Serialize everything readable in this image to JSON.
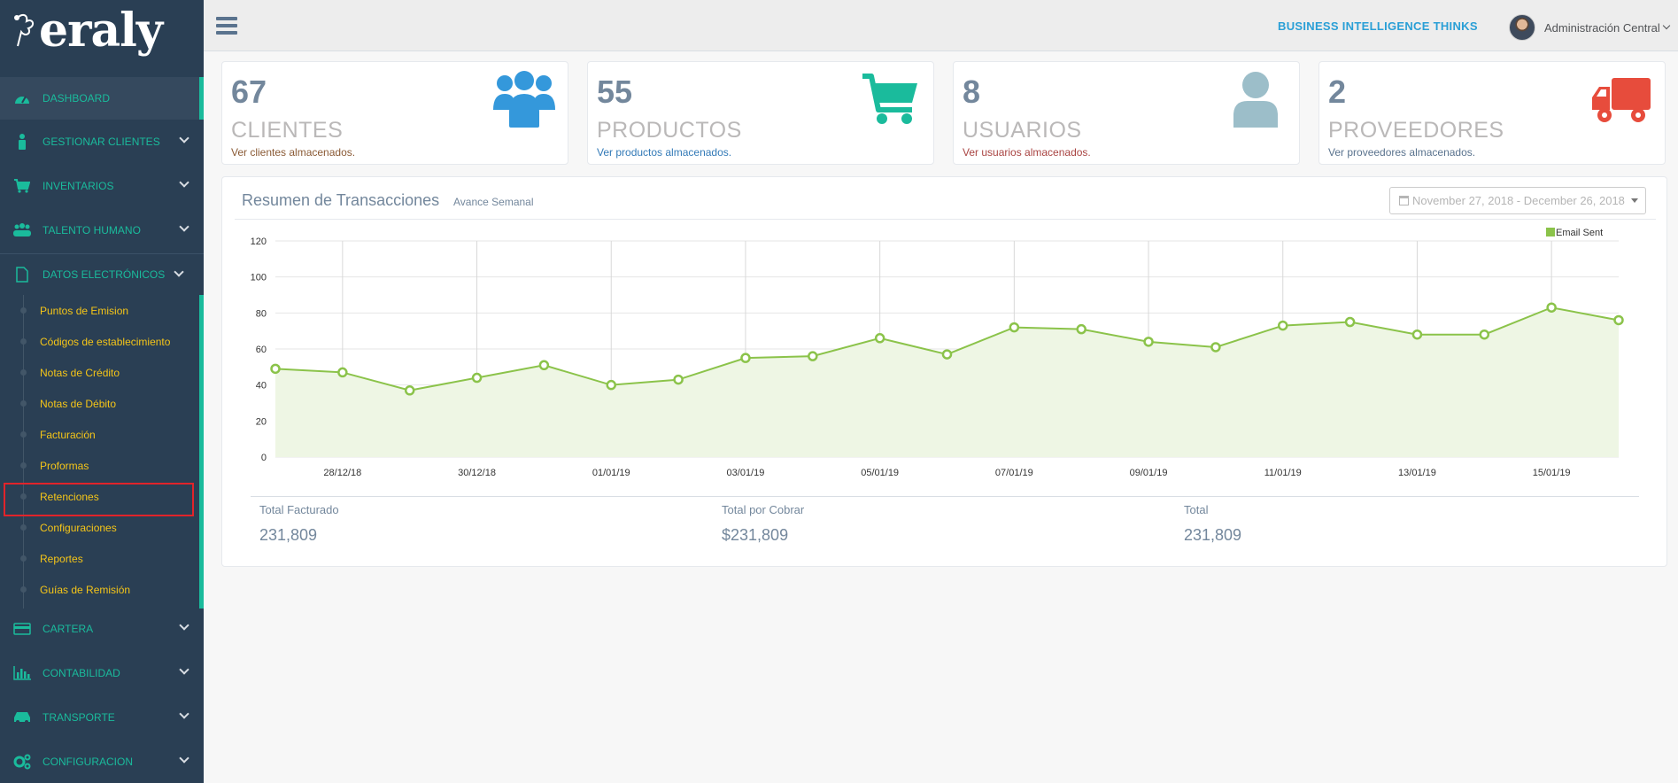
{
  "app": {
    "logo_text": "eraly",
    "header_title": "BUSINESS INTELLIGENCE THINKS",
    "user_name": "Administración Central"
  },
  "sidebar": {
    "items": [
      {
        "label": "DASHBOARD",
        "icon": "dashboard-icon"
      },
      {
        "label": "GESTIONAR CLIENTES",
        "icon": "user-icon"
      },
      {
        "label": "INVENTARIOS",
        "icon": "cart-icon"
      },
      {
        "label": "TALENTO HUMANO",
        "icon": "users-icon"
      },
      {
        "label": "DATOS ELECTRÓNICOS",
        "icon": "file-icon"
      },
      {
        "label": "CARTERA",
        "icon": "credit-card-icon"
      },
      {
        "label": "CONTABILIDAD",
        "icon": "bar-chart-icon"
      },
      {
        "label": "TRANSPORTE",
        "icon": "car-icon"
      },
      {
        "label": "CONFIGURACION",
        "icon": "cogs-icon"
      }
    ],
    "submenu": [
      "Puntos de Emision",
      "Códigos de establecimiento",
      "Notas de Crédito",
      "Notas de Débito",
      "Facturación",
      "Proformas",
      "Retenciones",
      "Configuraciones",
      "Reportes",
      "Guías de Remisión"
    ]
  },
  "stats": [
    {
      "count": "67",
      "name": "CLIENTES",
      "desc": "Ver clientes almacenados.",
      "color": "#8a5a35",
      "icon": "users-icon",
      "icon_color": "#3498db"
    },
    {
      "count": "55",
      "name": "PRODUCTOS",
      "desc": "Ver productos almacenados.",
      "color": "#337ab7",
      "icon": "cart-icon",
      "icon_color": "#1abb9c"
    },
    {
      "count": "8",
      "name": "USUARIOS",
      "desc": "Ver usuarios almacenados.",
      "color": "#a94442",
      "icon": "user-icon",
      "icon_color": "#9cbec9"
    },
    {
      "count": "2",
      "name": "PROVEEDORES",
      "desc": "Ver proveedores almacenados.",
      "color": "#5a738e",
      "icon": "truck-icon",
      "icon_color": "#e74c3c"
    }
  ],
  "panel": {
    "title": "Resumen de Transacciones",
    "subtitle": "Avance Semanal",
    "date_range": "November 27, 2018 - December 26, 2018"
  },
  "chart_data": {
    "type": "area",
    "series": [
      {
        "name": "Email Sent",
        "color": "#8bc34a",
        "x": [
          "2018-12-27",
          "2018-12-28",
          "2018-12-29",
          "2018-12-30",
          "2018-12-31",
          "2019-01-01",
          "2019-01-02",
          "2019-01-03",
          "2019-01-04",
          "2019-01-05",
          "2019-01-06",
          "2019-01-07",
          "2019-01-08",
          "2019-01-09",
          "2019-01-10",
          "2019-01-11",
          "2019-01-12",
          "2019-01-13",
          "2019-01-14",
          "2019-01-15",
          "2019-01-16"
        ],
        "values": [
          49,
          47,
          37,
          44,
          51,
          40,
          43,
          55,
          56,
          66,
          57,
          72,
          71,
          64,
          61,
          73,
          75,
          68,
          68,
          83,
          76
        ]
      }
    ],
    "x_tick_labels": [
      "28/12/18",
      "30/12/18",
      "01/01/19",
      "03/01/19",
      "05/01/19",
      "07/01/19",
      "09/01/19",
      "11/01/19",
      "13/01/19",
      "15/01/19"
    ],
    "y_ticks": [
      0,
      20,
      40,
      60,
      80,
      100,
      120
    ],
    "ylim": [
      0,
      120
    ],
    "grid": true,
    "legend_position": "top-right"
  },
  "totals": [
    {
      "label": "Total Facturado",
      "value": "231,809"
    },
    {
      "label": "Total por Cobrar",
      "value": "$231,809"
    },
    {
      "label": "Total",
      "value": "231,809"
    }
  ]
}
